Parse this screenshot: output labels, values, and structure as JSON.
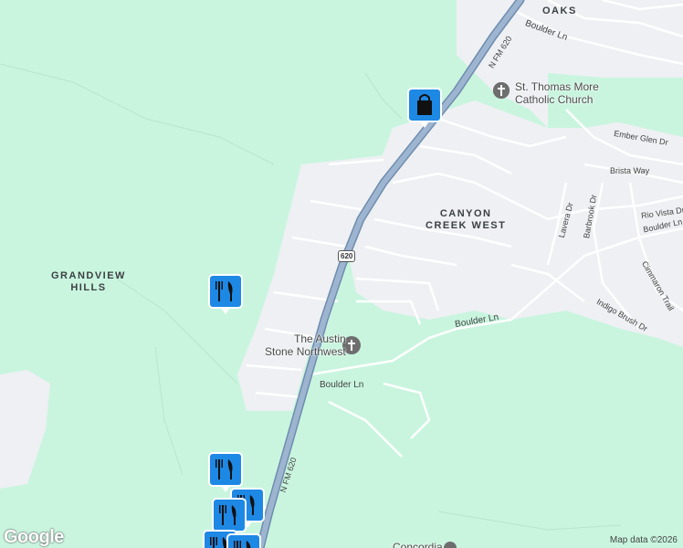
{
  "colors": {
    "park": "#c9f5df",
    "urban": "#eef0f3",
    "road": "#ffffff",
    "highway": "#8ba4c0",
    "marker": "#1e88e5"
  },
  "map": {
    "area_labels": {
      "oaks": "OAKS",
      "canyon_creek_west": "CANYON\nCREEK WEST",
      "grandview_hills": "GRANDVIEW\nHILLS"
    },
    "street_labels": {
      "boulder_ln_top": "Boulder Ln",
      "boulder_ln_mid": "Boulder Ln",
      "boulder_ln_bottom": "Boulder Ln",
      "fm620_top": "N FM 620",
      "fm620_bottom": "N FM 620",
      "ember_glen": "Ember Glen Dr",
      "brista_way": "Brista Way",
      "barbrook": "Barbrook Dr",
      "lavera": "Lavera Dr",
      "rio_vista": "Rio Vista Dr",
      "boulder_ln_right": "Boulder Ln",
      "cimmaron": "Cimmaron Trail",
      "indigo_brush": "Indigo Brush Dr"
    },
    "highway_shield": "620",
    "pois": {
      "st_thomas": "St. Thomas More\nCatholic Church",
      "austin_stone": "The Austin\nStone Northwest",
      "concordia": "Concordia"
    },
    "markers": [
      {
        "type": "shopping",
        "icon": "shopping-bag-icon"
      },
      {
        "type": "restaurant",
        "icon": "fork-knife-icon"
      },
      {
        "type": "restaurant",
        "icon": "fork-knife-icon"
      },
      {
        "type": "restaurant",
        "icon": "fork-knife-icon"
      },
      {
        "type": "restaurant",
        "icon": "fork-knife-icon"
      },
      {
        "type": "restaurant",
        "icon": "fork-knife-icon"
      }
    ],
    "logo": "Google",
    "attribution": "Map data ©2026"
  }
}
